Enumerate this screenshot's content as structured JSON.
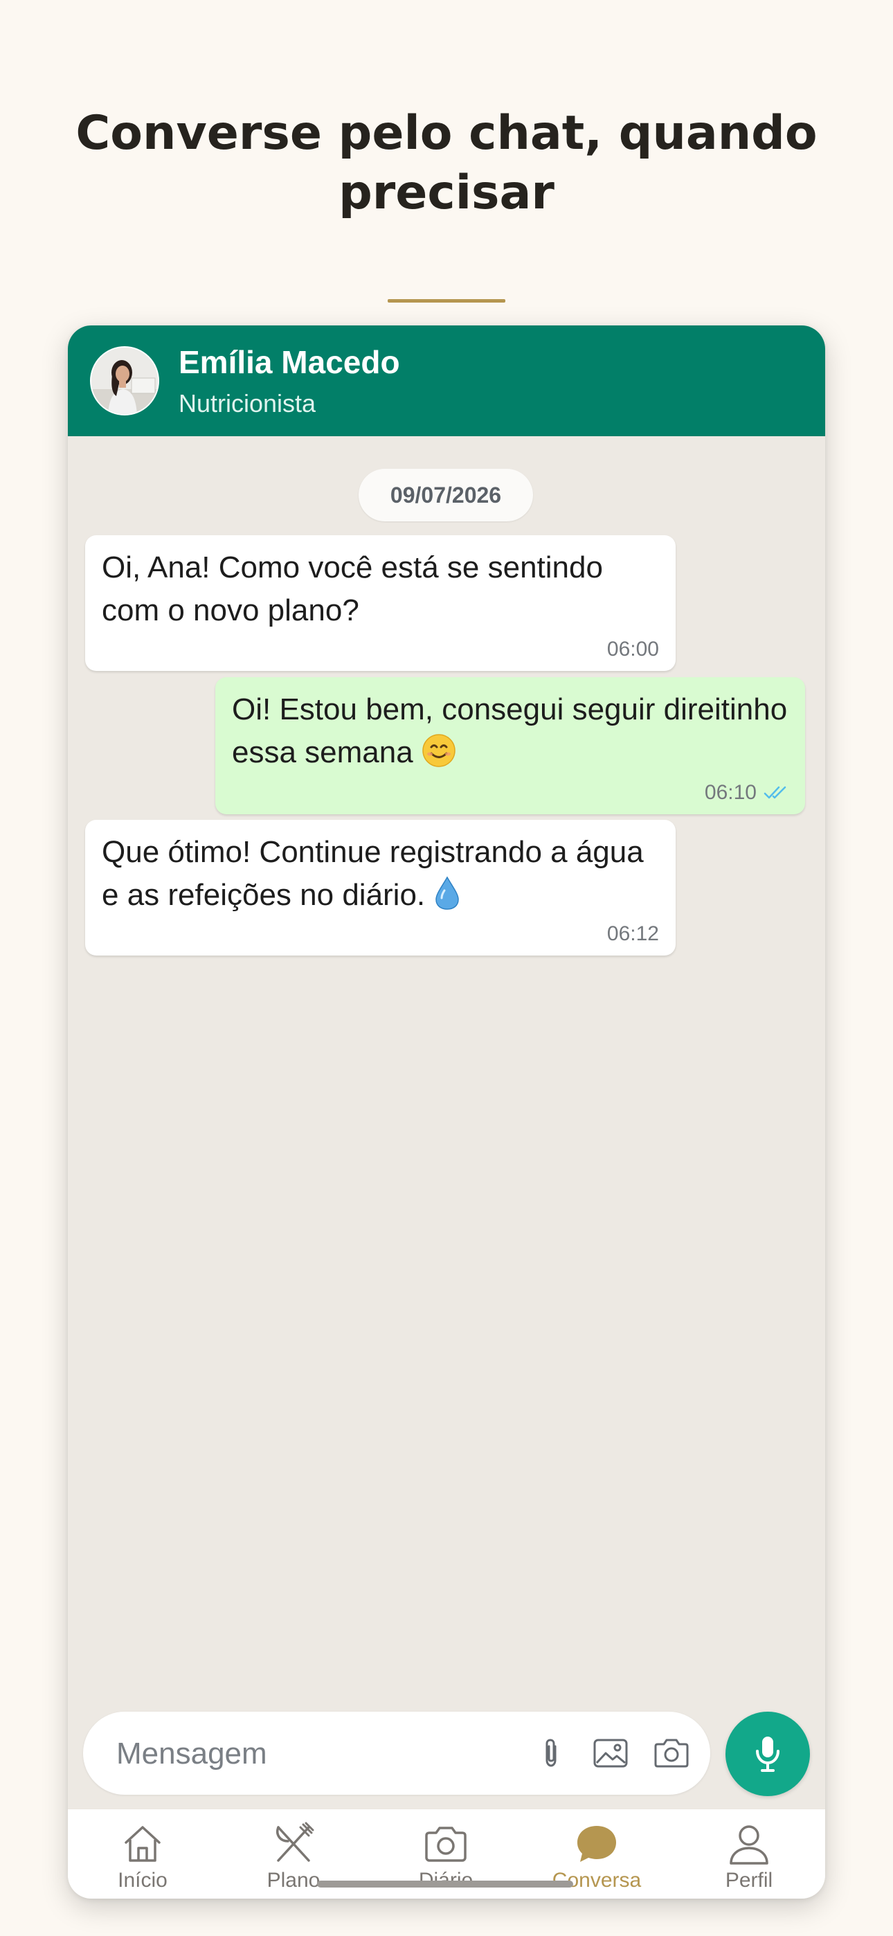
{
  "headline": "Converse pelo chat, quando precisar",
  "chat": {
    "contact_name": "Emília Macedo",
    "contact_role": "Nutricionista",
    "date": "09/07/2026",
    "messages": [
      {
        "direction": "in",
        "text": "Oi, Ana! Como você está se sentindo com o novo plano?",
        "time": "06:00"
      },
      {
        "direction": "out",
        "text": "Oi! Estou bem, consegui seguir direitinho essa semana",
        "emoji": "smiling-face-icon",
        "time": "06:10",
        "status": "read"
      },
      {
        "direction": "in",
        "text": "Que ótimo! Continue registrando a água e as refeições no diário.",
        "emoji": "water-drop-icon",
        "time": "06:12"
      }
    ]
  },
  "composer": {
    "placeholder": "Mensagem",
    "icons": [
      "paperclip-icon",
      "image-icon",
      "camera-icon",
      "microphone-icon"
    ]
  },
  "nav": {
    "items": [
      {
        "label": "Início",
        "icon": "home-icon"
      },
      {
        "label": "Plano",
        "icon": "fork-knife-icon"
      },
      {
        "label": "Diário",
        "icon": "camera-icon"
      },
      {
        "label": "Conversa",
        "icon": "chat-bubble-icon",
        "active": true
      },
      {
        "label": "Perfil",
        "icon": "person-icon"
      }
    ]
  },
  "colors": {
    "header": "#027f68",
    "accent_gold": "#b59650",
    "incoming_bubble": "#ffffff",
    "outgoing_bubble": "#d9fbd1",
    "chat_background": "#ede9e3",
    "mic_button": "#12a88a",
    "read_receipt": "#53bdeb"
  }
}
